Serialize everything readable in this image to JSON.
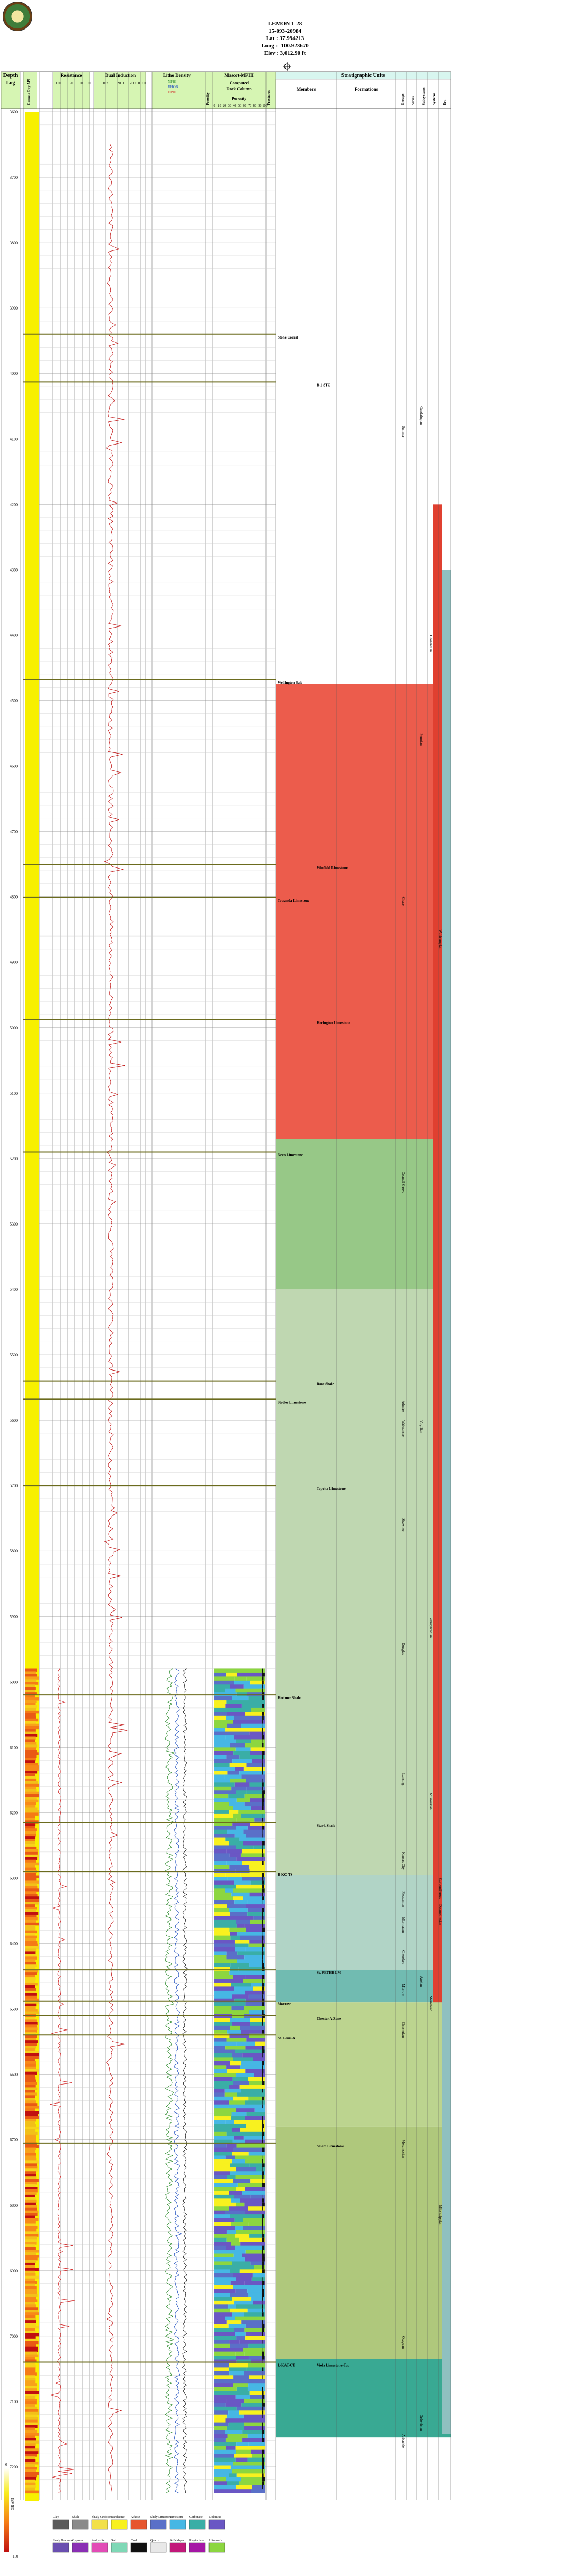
{
  "header": {
    "well_name": "LEMON 1-28",
    "api": "15-093-20984",
    "lat": "Lat : 37.994213",
    "long": "Long : -100.923670",
    "elev": "Elev : 3,012.90 ft"
  },
  "columns": {
    "depth_title": "Depth",
    "depth_sub": "Log",
    "gr_title": "Gamma Ray API",
    "resistance_title": "Resistance",
    "resistance_scale": [
      "0.0",
      "5.0",
      "10.0 0.0"
    ],
    "dual_induction_title": "Dual Induction",
    "dual_induction_scale": [
      "0.2",
      "20.0",
      "2000.0 0.0"
    ],
    "lithodensity_title": "Litho Density",
    "lithodensity_scale": [
      "NPHI",
      "RHOB",
      "DPHI"
    ],
    "lithodensity_sub": [
      "0.4  1.5",
      "1.5",
      "0.3"
    ],
    "porosity_title": "Porosity",
    "mascot_title": "Mascot-MPHI",
    "mascot_sub": [
      "Computed",
      "Rock Column",
      "Porosity"
    ],
    "mascot_ticks": [
      "0",
      "10",
      "20",
      "30",
      "40",
      "50",
      "60",
      "70",
      "80",
      "90",
      "100"
    ],
    "fracture_title": "Fractures",
    "strat_title": "Stratigraphic Units",
    "members_title": "Members",
    "formations_title": "Formations",
    "group_titles": [
      "Groups",
      "Series",
      "Subsystems",
      "Systems",
      "Era"
    ]
  },
  "depth_axis": {
    "min": 3600,
    "max": 6400,
    "ticks": [
      3600,
      3700,
      3800,
      3900,
      4000,
      4100,
      4200,
      4300,
      4400,
      4500,
      4600,
      4700,
      4800,
      4900,
      5000,
      5100,
      5200,
      5300,
      5400,
      5500,
      5600,
      5700,
      5800,
      5900,
      6000,
      6100,
      6200,
      6300,
      6400
    ]
  },
  "members": [
    {
      "name": "Stone Corral",
      "depth": 3940
    },
    {
      "name": "B-1 STC",
      "depth": 4013
    },
    {
      "name": "Wellington Salt",
      "depth": 4468
    },
    {
      "name": "Winfield Limestone",
      "depth": 4751
    },
    {
      "name": "Towanda Limestone",
      "depth": 4801
    },
    {
      "name": "Herington Limestone",
      "depth": 4988
    },
    {
      "name": "Neva Limestone",
      "depth": 5190
    },
    {
      "name": "Root Shale",
      "depth": 5540
    },
    {
      "name": "Stotler Limestone",
      "depth": 5568
    },
    {
      "name": "Topeka Limestone",
      "depth": 5700
    },
    {
      "name": "Heebner Shale",
      "depth": 6020
    },
    {
      "name": "Stark Shale",
      "depth": 6215
    },
    {
      "name": "B-KC-TS",
      "depth": 6290
    },
    {
      "name": "St. PETER LM",
      "depth": 6440
    },
    {
      "name": "Morrow",
      "depth": 6488
    },
    {
      "name": "Chester A Zone",
      "depth": 6510
    },
    {
      "name": "St. Louis A",
      "depth": 6540
    },
    {
      "name": "Salem Limestone",
      "depth": 6705
    },
    {
      "name": "L-KAT-CT",
      "depth": 7040
    },
    {
      "name": "Viola Limestone-Top",
      "depth": 7040
    }
  ],
  "strat_bands": [
    {
      "top": 4475,
      "bottom": 5170,
      "color": "#ea4a38"
    },
    {
      "top": 5170,
      "bottom": 5400,
      "color": "#8cc27a"
    },
    {
      "top": 5400,
      "bottom": 6295,
      "color": "#b8d3a8"
    },
    {
      "top": 6295,
      "bottom": 6440,
      "color": "#a8cfc0"
    },
    {
      "top": 6440,
      "bottom": 6490,
      "color": "#62b4a8"
    },
    {
      "top": 6490,
      "bottom": 6680,
      "color": "#b5cf83"
    },
    {
      "top": 6680,
      "bottom": 7035,
      "color": "#a6c26e"
    },
    {
      "top": 7035,
      "bottom": 7155,
      "color": "#23a087"
    }
  ],
  "unit_labels": [
    {
      "text": "Sumner",
      "depth": 4080
    },
    {
      "text": "Chase",
      "depth": 4800
    },
    {
      "text": "Council Grove",
      "depth": 5220
    },
    {
      "text": "Admire",
      "depth": 5570
    },
    {
      "text": "Wabaunsee",
      "depth": 5600
    },
    {
      "text": "Shawnee",
      "depth": 5750
    },
    {
      "text": "Douglas",
      "depth": 5940
    },
    {
      "text": "Lansing",
      "depth": 6140
    },
    {
      "text": "Kansas City",
      "depth": 6260
    },
    {
      "text": "Pleasanton",
      "depth": 6320
    },
    {
      "text": "Marmaton",
      "depth": 6360
    },
    {
      "text": "Cherokee",
      "depth": 6410
    },
    {
      "text": "Morrow",
      "depth": 6462
    },
    {
      "text": "Chesterian",
      "depth": 6520
    },
    {
      "text": "Meramecian",
      "depth": 6700
    },
    {
      "text": "Osagean",
      "depth": 7000
    },
    {
      "text": "Arbuckle",
      "depth": 7150
    }
  ],
  "system_labels": [
    {
      "text": "Guadalupian",
      "depth": 4050
    },
    {
      "text": "Leonardian",
      "depth": 4400
    },
    {
      "text": "Wolfcampian",
      "depth": 4850
    },
    {
      "text": "Virgilian",
      "depth": 5600
    },
    {
      "text": "Missourian",
      "depth": 6170
    },
    {
      "text": "Desmoinesian",
      "depth": 6340
    },
    {
      "text": "Atokan",
      "depth": 6450
    },
    {
      "text": "Morrowan",
      "depth": 6480
    },
    {
      "text": "Mississippian",
      "depth": 6800
    },
    {
      "text": "Permian",
      "depth": 4550
    },
    {
      "text": "Pennsylvanian",
      "depth": 5900
    },
    {
      "text": "Carboniferous",
      "depth": 6300
    },
    {
      "text": "Ordovician",
      "depth": 7120
    }
  ],
  "chart_data": {
    "type": "line",
    "title": "LEMON 1-28",
    "ylabel": "Depth",
    "ylim": [
      3600,
      7250
    ],
    "series": [
      {
        "name": "Resistance",
        "units": "ohm-m",
        "xlim": [
          0,
          10
        ]
      },
      {
        "name": "Dual Induction",
        "units": "ohm-m",
        "xlim": [
          0.2,
          2000
        ]
      },
      {
        "name": "NPHI",
        "xlim": [
          0.4,
          -0.1
        ]
      },
      {
        "name": "RHOB",
        "xlim": [
          1.5,
          3.0
        ]
      }
    ],
    "formation_tops": [
      3940,
      4013,
      4468,
      4751,
      4801,
      4988,
      5190,
      5540,
      5568,
      5700,
      6020,
      6215,
      6290,
      6440,
      6488,
      6510,
      6540,
      6705,
      7040
    ]
  },
  "legend": {
    "row1": [
      {
        "name": "Clay",
        "color": "#5a5a5a"
      },
      {
        "name": "Shale",
        "color": "#8a8a8a"
      },
      {
        "name": "Shaly Sandstone",
        "color": "#f2e04a"
      },
      {
        "name": "Sandstone",
        "color": "#f8f11f"
      },
      {
        "name": "Arkose",
        "color": "#e6562f"
      },
      {
        "name": "Shaly Limestone",
        "color": "#5a70c8"
      },
      {
        "name": "Limestone",
        "color": "#46b7e4"
      },
      {
        "name": "Carbonate",
        "color": "#3aaea6"
      },
      {
        "name": "Dolomite",
        "color": "#6a57c4"
      }
    ],
    "row2": [
      {
        "name": "Shaly Dolomite",
        "color": "#6a4fb0"
      },
      {
        "name": "Gypsum",
        "color": "#8a2fb4"
      },
      {
        "name": "Anhydrite",
        "color": "#e24cb6"
      },
      {
        "name": "Salt",
        "color": "#7fd8b6"
      },
      {
        "name": "Coal",
        "color": "#111111"
      },
      {
        "name": "Quartz",
        "color": "#e8e8e8"
      },
      {
        "name": "K-Feldspar",
        "color": "#c2187a"
      },
      {
        "name": "Plagioclase",
        "color": "#a516a5"
      },
      {
        "name": "Ultramafic",
        "color": "#8cd640"
      }
    ],
    "gr_scale_label": "GR API",
    "gr_scale_top": "0",
    "gr_scale_bottom": "150"
  }
}
